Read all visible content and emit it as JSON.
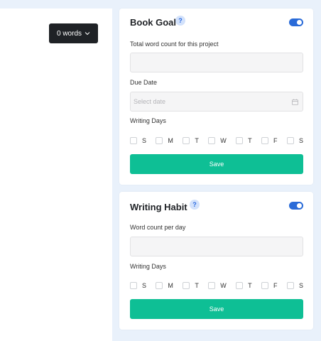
{
  "editor": {
    "word_count_label": "0 words"
  },
  "book_goal": {
    "title": "Book Goal",
    "help": "?",
    "enabled": true,
    "total_label": "Total word count for this project",
    "total_value": "",
    "due_label": "Due Date",
    "due_placeholder": "Select date",
    "days_label": "Writing Days",
    "days": [
      "S",
      "M",
      "T",
      "W",
      "T",
      "F",
      "S"
    ],
    "save_label": "Save"
  },
  "writing_habit": {
    "title": "Writing Habit",
    "help": "?",
    "enabled": true,
    "per_day_label": "Word count per day",
    "per_day_value": "",
    "days_label": "Writing Days",
    "days": [
      "S",
      "M",
      "T",
      "W",
      "T",
      "F",
      "S"
    ],
    "save_label": "Save"
  },
  "colors": {
    "accent": "#0ebf95",
    "toggle": "#2a6bd8",
    "background": "#e9f1fb",
    "dark_button": "#1f2226"
  }
}
